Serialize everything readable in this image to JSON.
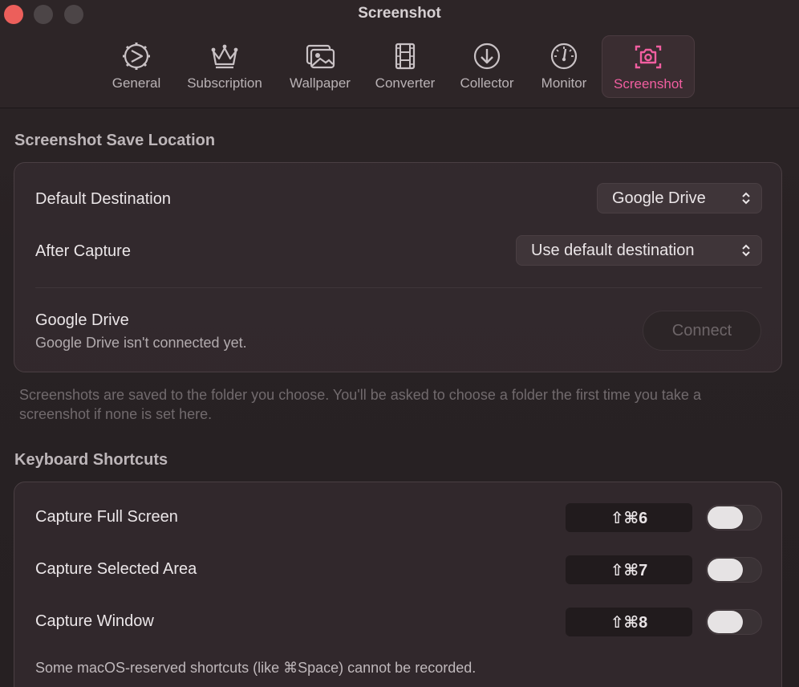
{
  "window": {
    "title": "Screenshot"
  },
  "tabs": [
    {
      "label": "General",
      "icon": "gear-icon"
    },
    {
      "label": "Subscription",
      "icon": "crown-icon"
    },
    {
      "label": "Wallpaper",
      "icon": "wallpaper-icon"
    },
    {
      "label": "Converter",
      "icon": "film-icon"
    },
    {
      "label": "Collector",
      "icon": "download-icon"
    },
    {
      "label": "Monitor",
      "icon": "gauge-icon"
    },
    {
      "label": "Screenshot",
      "icon": "camera-icon",
      "active": true
    }
  ],
  "save_location": {
    "heading": "Screenshot Save Location",
    "default_destination": {
      "label": "Default Destination",
      "value": "Google Drive"
    },
    "after_capture": {
      "label": "After Capture",
      "value": "Use default destination"
    },
    "google_drive": {
      "label": "Google Drive",
      "status": "Google Drive isn't connected yet.",
      "button": "Connect"
    },
    "help": "Screenshots are saved to the folder you choose. You'll be asked to choose a folder the first time you take a screenshot if none is set here."
  },
  "shortcuts": {
    "heading": "Keyboard Shortcuts",
    "items": [
      {
        "label": "Capture Full Screen",
        "keys": "⇧⌘6",
        "enabled": false
      },
      {
        "label": "Capture Selected Area",
        "keys": "⇧⌘7",
        "enabled": false
      },
      {
        "label": "Capture Window",
        "keys": "⇧⌘8",
        "enabled": false
      }
    ],
    "note": "Some macOS-reserved shortcuts (like ⌘Space) cannot be recorded."
  },
  "colors": {
    "accent": "#f15ea0",
    "close_button": "#ec5f5b"
  }
}
